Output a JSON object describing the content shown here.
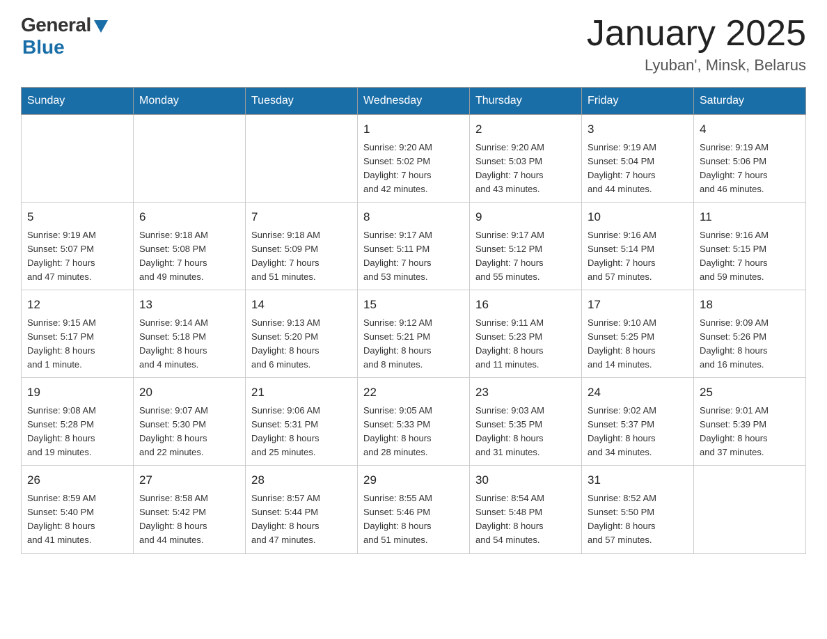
{
  "logo": {
    "general": "General",
    "blue": "Blue"
  },
  "title": "January 2025",
  "location": "Lyuban', Minsk, Belarus",
  "weekdays": [
    "Sunday",
    "Monday",
    "Tuesday",
    "Wednesday",
    "Thursday",
    "Friday",
    "Saturday"
  ],
  "weeks": [
    [
      {
        "day": "",
        "info": ""
      },
      {
        "day": "",
        "info": ""
      },
      {
        "day": "",
        "info": ""
      },
      {
        "day": "1",
        "info": "Sunrise: 9:20 AM\nSunset: 5:02 PM\nDaylight: 7 hours\nand 42 minutes."
      },
      {
        "day": "2",
        "info": "Sunrise: 9:20 AM\nSunset: 5:03 PM\nDaylight: 7 hours\nand 43 minutes."
      },
      {
        "day": "3",
        "info": "Sunrise: 9:19 AM\nSunset: 5:04 PM\nDaylight: 7 hours\nand 44 minutes."
      },
      {
        "day": "4",
        "info": "Sunrise: 9:19 AM\nSunset: 5:06 PM\nDaylight: 7 hours\nand 46 minutes."
      }
    ],
    [
      {
        "day": "5",
        "info": "Sunrise: 9:19 AM\nSunset: 5:07 PM\nDaylight: 7 hours\nand 47 minutes."
      },
      {
        "day": "6",
        "info": "Sunrise: 9:18 AM\nSunset: 5:08 PM\nDaylight: 7 hours\nand 49 minutes."
      },
      {
        "day": "7",
        "info": "Sunrise: 9:18 AM\nSunset: 5:09 PM\nDaylight: 7 hours\nand 51 minutes."
      },
      {
        "day": "8",
        "info": "Sunrise: 9:17 AM\nSunset: 5:11 PM\nDaylight: 7 hours\nand 53 minutes."
      },
      {
        "day": "9",
        "info": "Sunrise: 9:17 AM\nSunset: 5:12 PM\nDaylight: 7 hours\nand 55 minutes."
      },
      {
        "day": "10",
        "info": "Sunrise: 9:16 AM\nSunset: 5:14 PM\nDaylight: 7 hours\nand 57 minutes."
      },
      {
        "day": "11",
        "info": "Sunrise: 9:16 AM\nSunset: 5:15 PM\nDaylight: 7 hours\nand 59 minutes."
      }
    ],
    [
      {
        "day": "12",
        "info": "Sunrise: 9:15 AM\nSunset: 5:17 PM\nDaylight: 8 hours\nand 1 minute."
      },
      {
        "day": "13",
        "info": "Sunrise: 9:14 AM\nSunset: 5:18 PM\nDaylight: 8 hours\nand 4 minutes."
      },
      {
        "day": "14",
        "info": "Sunrise: 9:13 AM\nSunset: 5:20 PM\nDaylight: 8 hours\nand 6 minutes."
      },
      {
        "day": "15",
        "info": "Sunrise: 9:12 AM\nSunset: 5:21 PM\nDaylight: 8 hours\nand 8 minutes."
      },
      {
        "day": "16",
        "info": "Sunrise: 9:11 AM\nSunset: 5:23 PM\nDaylight: 8 hours\nand 11 minutes."
      },
      {
        "day": "17",
        "info": "Sunrise: 9:10 AM\nSunset: 5:25 PM\nDaylight: 8 hours\nand 14 minutes."
      },
      {
        "day": "18",
        "info": "Sunrise: 9:09 AM\nSunset: 5:26 PM\nDaylight: 8 hours\nand 16 minutes."
      }
    ],
    [
      {
        "day": "19",
        "info": "Sunrise: 9:08 AM\nSunset: 5:28 PM\nDaylight: 8 hours\nand 19 minutes."
      },
      {
        "day": "20",
        "info": "Sunrise: 9:07 AM\nSunset: 5:30 PM\nDaylight: 8 hours\nand 22 minutes."
      },
      {
        "day": "21",
        "info": "Sunrise: 9:06 AM\nSunset: 5:31 PM\nDaylight: 8 hours\nand 25 minutes."
      },
      {
        "day": "22",
        "info": "Sunrise: 9:05 AM\nSunset: 5:33 PM\nDaylight: 8 hours\nand 28 minutes."
      },
      {
        "day": "23",
        "info": "Sunrise: 9:03 AM\nSunset: 5:35 PM\nDaylight: 8 hours\nand 31 minutes."
      },
      {
        "day": "24",
        "info": "Sunrise: 9:02 AM\nSunset: 5:37 PM\nDaylight: 8 hours\nand 34 minutes."
      },
      {
        "day": "25",
        "info": "Sunrise: 9:01 AM\nSunset: 5:39 PM\nDaylight: 8 hours\nand 37 minutes."
      }
    ],
    [
      {
        "day": "26",
        "info": "Sunrise: 8:59 AM\nSunset: 5:40 PM\nDaylight: 8 hours\nand 41 minutes."
      },
      {
        "day": "27",
        "info": "Sunrise: 8:58 AM\nSunset: 5:42 PM\nDaylight: 8 hours\nand 44 minutes."
      },
      {
        "day": "28",
        "info": "Sunrise: 8:57 AM\nSunset: 5:44 PM\nDaylight: 8 hours\nand 47 minutes."
      },
      {
        "day": "29",
        "info": "Sunrise: 8:55 AM\nSunset: 5:46 PM\nDaylight: 8 hours\nand 51 minutes."
      },
      {
        "day": "30",
        "info": "Sunrise: 8:54 AM\nSunset: 5:48 PM\nDaylight: 8 hours\nand 54 minutes."
      },
      {
        "day": "31",
        "info": "Sunrise: 8:52 AM\nSunset: 5:50 PM\nDaylight: 8 hours\nand 57 minutes."
      },
      {
        "day": "",
        "info": ""
      }
    ]
  ]
}
